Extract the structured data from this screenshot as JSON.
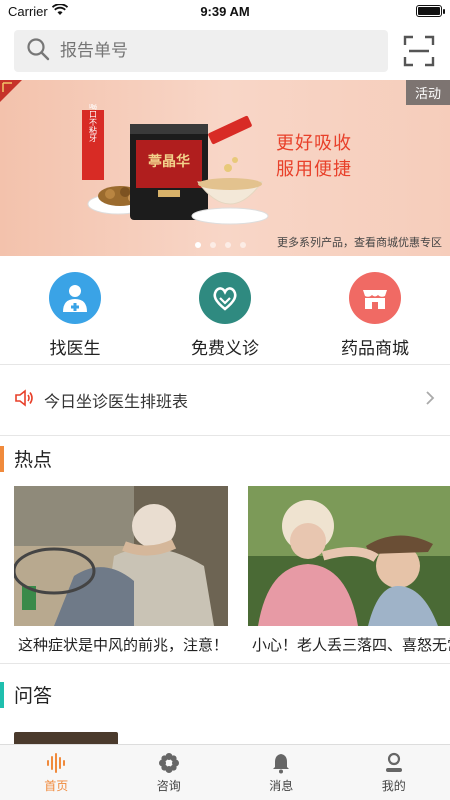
{
  "status_bar": {
    "carrier": "Carrier",
    "time": "9:39 AM"
  },
  "search": {
    "placeholder": "报告单号"
  },
  "banner": {
    "badge": "活动",
    "product_brand": "葶晶华",
    "side_text": "好喝口不粘牙",
    "slogan_line1": "更好吸收",
    "slogan_line2": "服用便捷",
    "caption": "更多系列产品，查看商城优惠专区",
    "slide_count": 4,
    "active_slide": 0
  },
  "quick_menu": [
    {
      "label": "找医生",
      "icon": "doctor-icon",
      "color": "#3aa3e6"
    },
    {
      "label": "免费义诊",
      "icon": "heart-hands-icon",
      "color": "#2f8a80"
    },
    {
      "label": "药品商城",
      "icon": "shop-icon",
      "color": "#f06a64"
    }
  ],
  "notice": {
    "text": "今日坐诊医生排班表"
  },
  "hot": {
    "title": "热点",
    "accent": "#f08a3c",
    "articles": [
      {
        "title": "这种症状是中风的前兆，注意！"
      },
      {
        "title": "小心！老人丢三落四、喜怒无常"
      }
    ]
  },
  "qa": {
    "title": "问答",
    "accent": "#1fbfae",
    "items": [
      {
        "text": ""
      }
    ]
  },
  "tabbar": [
    {
      "label": "首页",
      "icon": "home-wave-icon",
      "active": true
    },
    {
      "label": "咨询",
      "icon": "flower-icon",
      "active": false
    },
    {
      "label": "消息",
      "icon": "bell-icon",
      "active": false
    },
    {
      "label": "我的",
      "icon": "profile-icon",
      "active": false
    }
  ],
  "colors": {
    "active_tab": "#f08a3c",
    "slogan": "#e8402a"
  }
}
